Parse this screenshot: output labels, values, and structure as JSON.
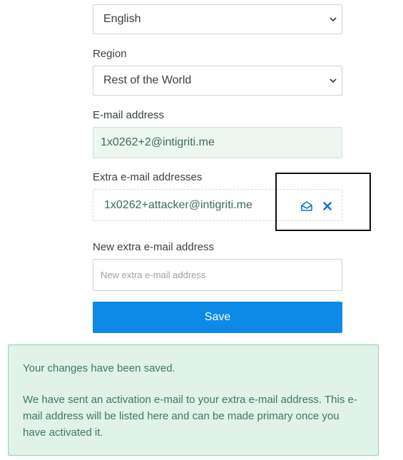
{
  "form": {
    "language": {
      "value": "English"
    },
    "region": {
      "label": "Region",
      "value": "Rest of the World"
    },
    "email": {
      "label": "E-mail address",
      "value": "1x0262+2@intigriti.me"
    },
    "extra_emails": {
      "label": "Extra e-mail addresses",
      "items": [
        {
          "value": "1x0262+attacker@intigriti.me",
          "actions": [
            "envelope-open-icon",
            "close-icon"
          ]
        }
      ]
    },
    "new_extra_email": {
      "label": "New extra e-mail address",
      "placeholder": "New extra e-mail address",
      "value": ""
    },
    "save_label": "Save"
  },
  "alert": {
    "line1": "Your changes have been saved.",
    "line2": "We have sent an activation e-mail to your extra e-mail address. This e-mail address will be listed here and can be made primary once you have activated it."
  },
  "colors": {
    "accent": "#0d8ae8",
    "success_bg": "#dff3e8",
    "success_border": "#8fd3b0",
    "success_text": "#3d7a5e",
    "highlight_border": "#111111"
  }
}
